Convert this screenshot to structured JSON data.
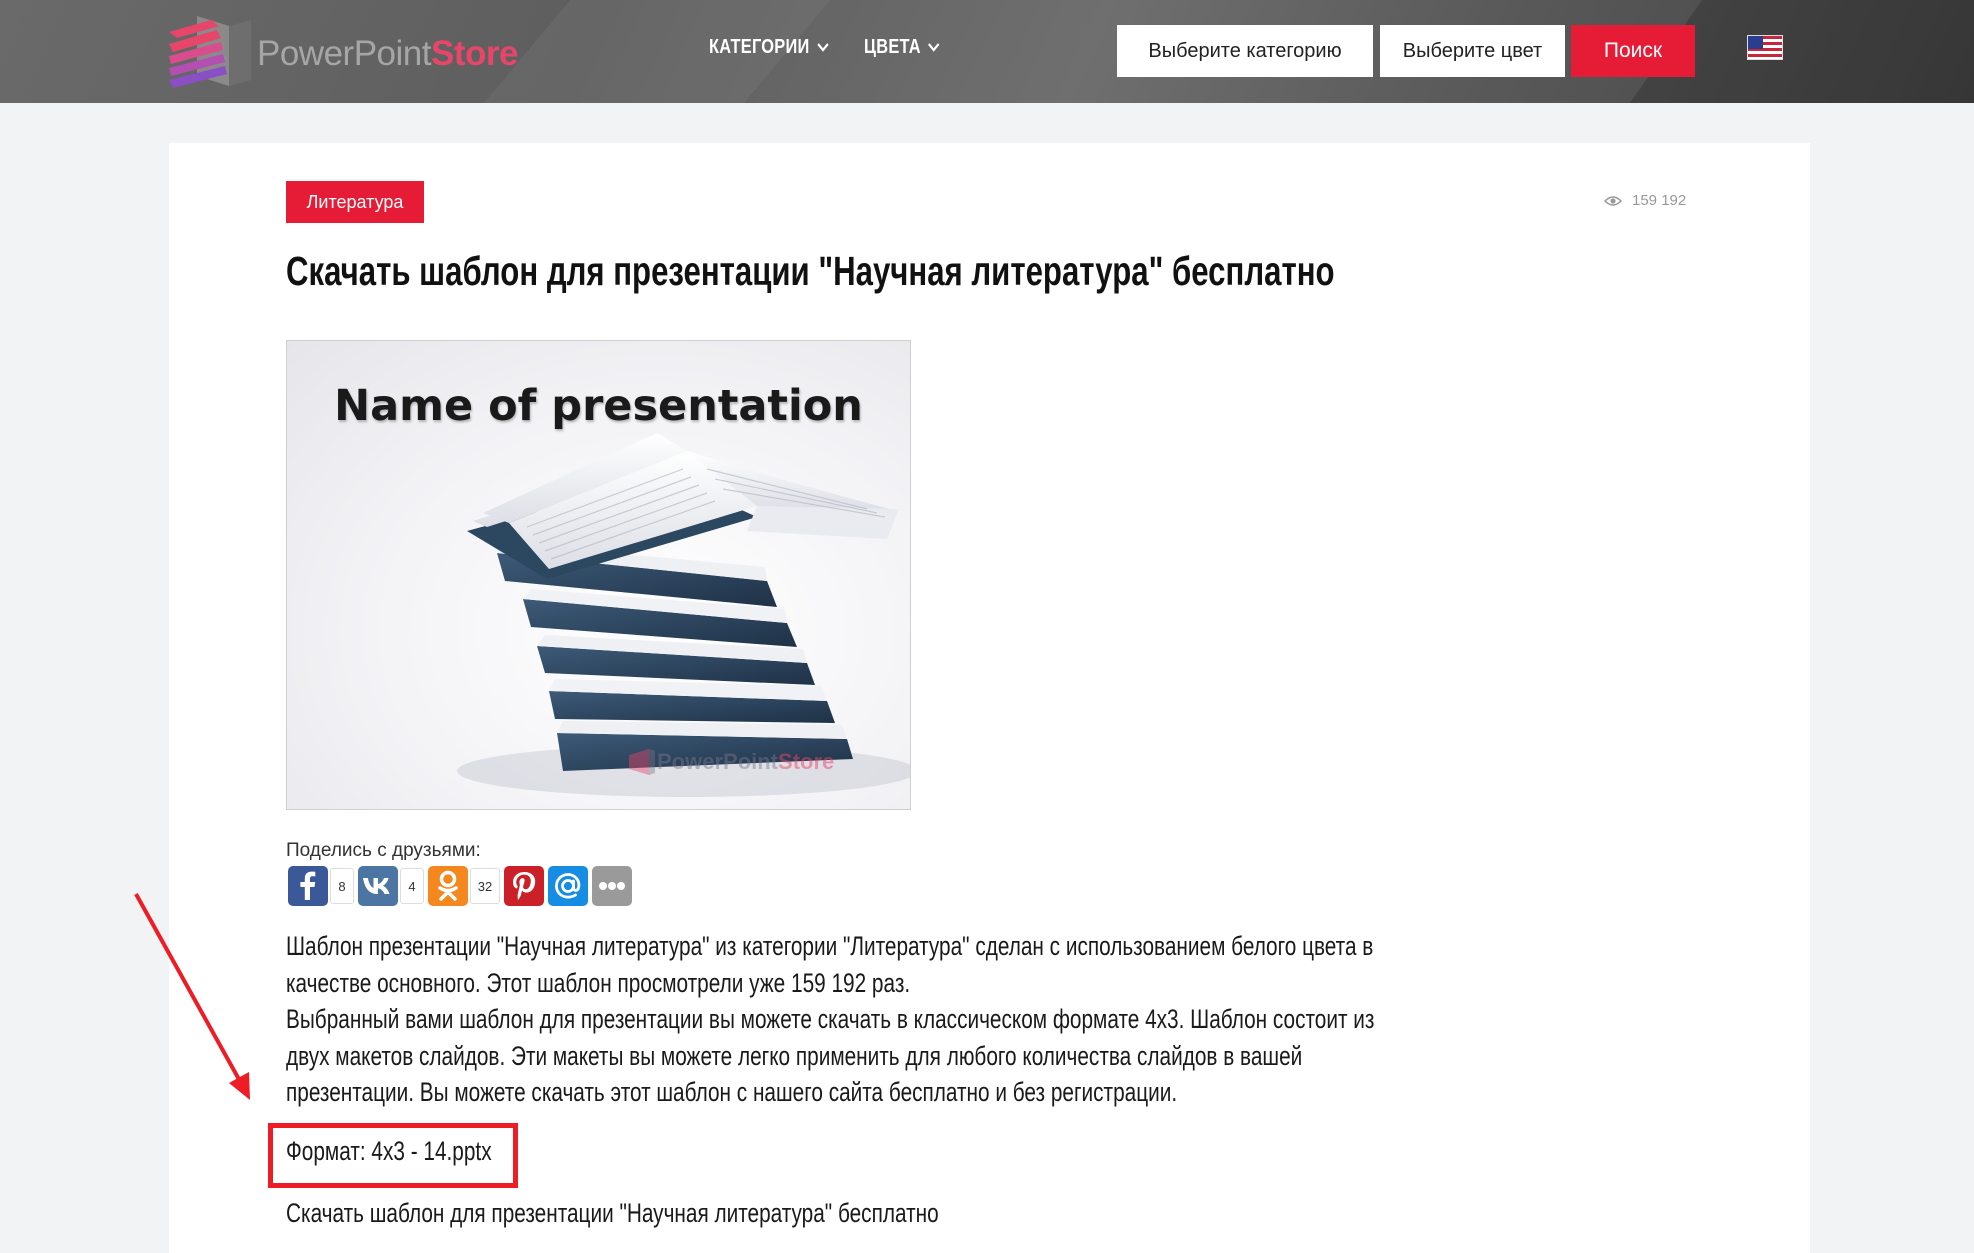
{
  "header": {
    "logo": {
      "part1": "PowerPoint",
      "part2": "Store"
    },
    "nav": [
      {
        "label": "КАТЕГОРИИ"
      },
      {
        "label": "ЦВЕТА"
      }
    ],
    "category_select": {
      "value": "Выберите категорию"
    },
    "color_select": {
      "value": "Выберите цвет"
    },
    "search_label": "Поиск",
    "language_flag": "us-flag-icon"
  },
  "article": {
    "category_badge": "Литература",
    "views": "159 192",
    "title": "Скачать шаблон для презентации \"Научная литература\" бесплатно",
    "preview": {
      "heading": "Name of presentation",
      "watermark": {
        "part1": "PowerPoint",
        "part2": "Store"
      }
    },
    "share": {
      "label": "Поделись с друзьями:",
      "buttons": [
        {
          "network": "facebook",
          "icon": "facebook-icon",
          "count": "8",
          "color": "#3b5998"
        },
        {
          "network": "vk",
          "icon": "vk-icon",
          "count": "4",
          "color": "#4c75a3"
        },
        {
          "network": "odnoklassniki",
          "icon": "odnoklassniki-icon",
          "count": "32",
          "color": "#f5871f"
        },
        {
          "network": "pinterest",
          "icon": "pinterest-icon",
          "color": "#cb2027"
        },
        {
          "network": "mail",
          "icon": "mail-ru-icon",
          "color": "#168de2"
        },
        {
          "network": "more",
          "icon": "more-icon",
          "color": "#9a9a9a"
        }
      ]
    },
    "paragraph1": "Шаблон презентации \"Научная литература\" из категории \"Литература\" сделан с использованием белого цвета в качестве основного. Этот шаблон просмотрели уже 159 192 раз.",
    "paragraph2": "Выбранный вами шаблон для презентации вы можете скачать в классическом формате 4x3. Шаблон состоит из двух макетов слайдов. Эти макеты вы можете легко применить для любого количества слайдов в вашей презентации. Вы можете скачать этот шаблон с нашего сайта бесплатно и без регистрации.",
    "format": "Формат: 4x3 - 14.pptx",
    "download_text": "Скачать шаблон для презентации \"Научная литература\" бесплатно"
  },
  "colors": {
    "accent_red": "#e61b35",
    "annotation_red": "#ee1c25",
    "header_gray": "#5e5e5e"
  }
}
